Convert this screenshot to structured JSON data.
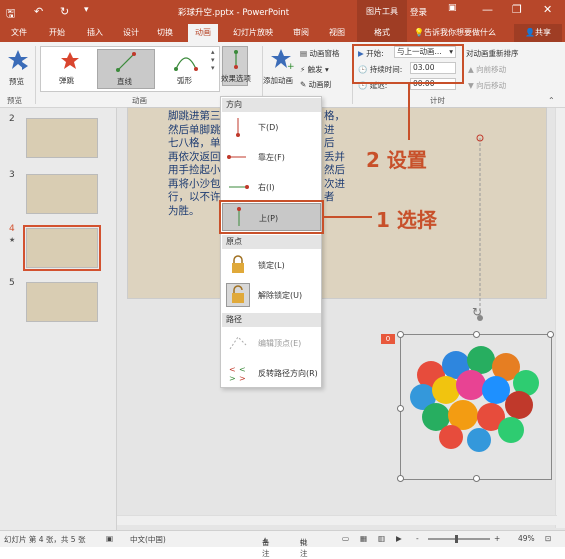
{
  "title_bar": {
    "document_title": "彩球升空.pptx - PowerPoint",
    "picture_tools": "图片工具",
    "login": "登录",
    "icons": [
      "save-icon",
      "undo-icon",
      "redo-icon",
      "customize-icon",
      "minimize-icon",
      "restore-icon",
      "close-icon"
    ]
  },
  "tabs": [
    "文件",
    "开始",
    "插入",
    "设计",
    "切换",
    "动画",
    "幻灯片放映",
    "审阅",
    "视图",
    "格式"
  ],
  "active_tab": "动画",
  "tell_me": "告诉我你想要做什么",
  "share": "共享",
  "ribbon": {
    "preview_label": "预览",
    "preview_group": "预览",
    "animations": [
      "弹跳",
      "直线",
      "弧形"
    ],
    "animation_group": "动画",
    "effect_options": "效果选项",
    "add_animation": "添加动画",
    "animation_pane": "动画窗格",
    "trigger": "触发",
    "animation_painter": "动画刷",
    "start_label": "开始:",
    "start_value": "与上一动画...",
    "duration_label": "持续时间:",
    "duration_value": "03.00",
    "delay_label": "延迟:",
    "delay_value": "00.00",
    "timing_group": "计时",
    "reorder": "对动画重新排序",
    "move_earlier": "向前移动",
    "move_later": "向后移动"
  },
  "slides": [
    {
      "num": "2"
    },
    {
      "num": "3"
    },
    {
      "num": "4",
      "selected": true,
      "star": "★"
    },
    {
      "num": "5"
    }
  ],
  "slide_text": [
    "脚跳进第三",
    "然后单脚跳",
    "七八格，单",
    "再依次返回",
    "用手捡起小",
    "再将小沙包",
    "行，以不许",
    "为胜。"
  ],
  "slide_text_right": [
    "格，",
    "进",
    "后",
    "丢并",
    "然后",
    "次进",
    "者"
  ],
  "effect_menu": {
    "direction_header": "方向",
    "down": "下(D)",
    "left": "靠左(F)",
    "right": "右(I)",
    "up": "上(P)",
    "origin_header": "原点",
    "locked": "锁定(L)",
    "unlocked": "解除锁定(U)",
    "path_header": "路径",
    "edit_points": "编辑顶点(E)",
    "reverse": "反转路径方向(R)"
  },
  "annotations": {
    "step1": "1 选择",
    "step2": "2 设置"
  },
  "anim_badge": "0",
  "status": {
    "slide_info": "幻灯片 第 4 张，共 5 张",
    "language": "中文(中国)",
    "notes": "备注",
    "comments": "批注",
    "zoom": "49%",
    "plus": "+",
    "minus": "-"
  },
  "colors": {
    "accent": "#b7472a",
    "annotation": "#c8502a",
    "slide_text": "#1f3d73"
  }
}
